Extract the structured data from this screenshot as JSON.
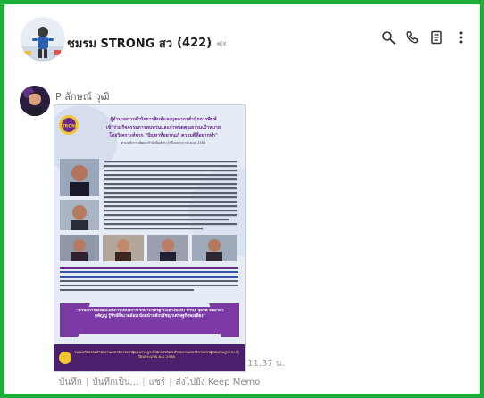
{
  "header": {
    "title": "ชมรม STRONG สว",
    "member_count": "(422)",
    "icons": [
      "mute-icon",
      "search-icon",
      "phone-icon",
      "notes-icon",
      "more-icon"
    ]
  },
  "message": {
    "sender": "P ลักษณ์ วุฒิ",
    "time": "11.37 น.",
    "poster": {
      "headline": [
        "ผู้อำนวยการสำนักการพิมพ์และบุคลากรสำนักการพิมพ์",
        "เข้าร่วมกิจกรรมการทบทวนและกำหนดคุณธรรมเป้าหมาย",
        "โดยวิเคราะห์จาก \"ปัญหาที่อยากแก้ ความดีที่อยากทำ\"",
        "ตามหลักการพัฒนาสำนักพิมพ์ประจำปีงบประมาณ พ.ศ. 2568"
      ],
      "quote": "\"สำนักการพิมพ์มีแผนการให้บริการ รักษามาตรฐานอย่างยั่งยืน มีวินัย สุจริต จิตอาสา กตัญญู รู้รักษ์สิ่งแวดล้อม น้อมนำหลักปรัชญาเศรษฐกิจพอเพียง\"",
      "footer": "ชมรมจริยธรรมสำนักงานเลขาธิการสภาผู้แทนราษฎร สำนักการพิมพ์ สำนักงานเลขาธิการสภาผู้แทนราษฎร ประจำปีงบประมาณ พ.ศ. 2568",
      "logo_text": "STRONG"
    }
  },
  "actions": [
    "บันทึก",
    "บันทึกเป็น...",
    "แชร์",
    "ส่งไปยัง Keep Memo"
  ],
  "colors": {
    "frame": "#1fae3c",
    "poster_purple": "#6a2a8c",
    "poster_bg": "#e6ecf6"
  }
}
